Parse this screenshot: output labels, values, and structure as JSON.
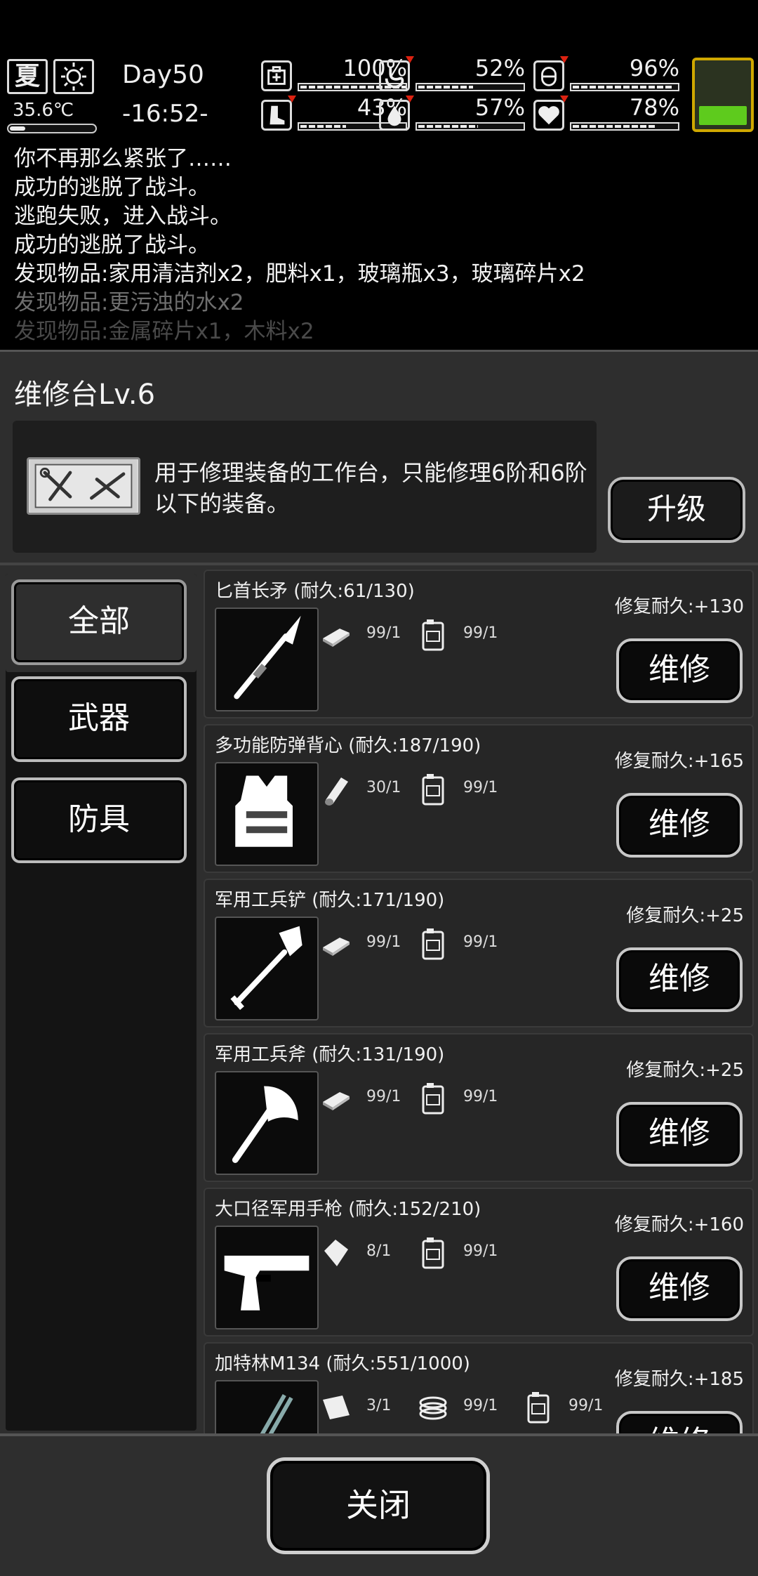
{
  "status": {
    "season": "夏",
    "temperature": "35.6℃",
    "temperature_fill": 0.18,
    "day": "Day50",
    "clock": "-16:52-",
    "battery_level": 0.3,
    "stats": [
      {
        "name": "health",
        "icon": "first-aid-icon",
        "value": "100%",
        "fill": 1.0,
        "falling": false
      },
      {
        "name": "hunger",
        "icon": "stomach-icon",
        "value": "52%",
        "fill": 0.52,
        "falling": true
      },
      {
        "name": "mood",
        "icon": "pill-icon",
        "value": "96%",
        "fill": 0.96,
        "falling": true
      },
      {
        "name": "stamina",
        "icon": "boot-icon",
        "value": "43%",
        "fill": 0.43,
        "falling": true
      },
      {
        "name": "thirst",
        "icon": "water-drop-icon",
        "value": "57%",
        "fill": 0.57,
        "falling": true
      },
      {
        "name": "spirit",
        "icon": "heart-icon",
        "value": "78%",
        "fill": 0.78,
        "falling": true
      }
    ]
  },
  "log": [
    "你不再那么紧张了……",
    "成功的逃脱了战斗。",
    "逃跑失败，进入战斗。",
    "成功的逃脱了战斗。",
    "发现物品:家用清洁剂x2，肥料x1，玻璃瓶x3，玻璃碎片x2",
    "发现物品:更污浊的水x2",
    "发现物品:金属碎片x1，木料x2"
  ],
  "workbench": {
    "title": "维修台Lv.6",
    "description": "用于修理装备的工作台，只能修理6阶和6阶以下的装备。",
    "upgrade_label": "升级"
  },
  "tabs": [
    {
      "label": "全部",
      "active": true
    },
    {
      "label": "武器",
      "active": false
    },
    {
      "label": "防具",
      "active": false
    }
  ],
  "repair_label": "维修",
  "items": [
    {
      "name": "匕首长矛 (耐久:61/130)",
      "repair": "修复耐久:+130",
      "icon": "spear-icon",
      "materials": [
        {
          "icon": "metal-plate-icon",
          "count": "99/1"
        },
        {
          "icon": "jerrycan-icon",
          "count": "99/1"
        }
      ]
    },
    {
      "name": "多功能防弹背心 (耐久:187/190)",
      "repair": "修复耐久:+165",
      "icon": "vest-icon",
      "materials": [
        {
          "icon": "cloth-roll-icon",
          "count": "30/1"
        },
        {
          "icon": "jerrycan-icon",
          "count": "99/1"
        }
      ]
    },
    {
      "name": "军用工兵铲 (耐久:171/190)",
      "repair": "修复耐久:+25",
      "icon": "shovel-icon",
      "materials": [
        {
          "icon": "metal-plate-icon",
          "count": "99/1"
        },
        {
          "icon": "jerrycan-icon",
          "count": "99/1"
        }
      ]
    },
    {
      "name": "军用工兵斧 (耐久:131/190)",
      "repair": "修复耐久:+25",
      "icon": "axe-icon",
      "materials": [
        {
          "icon": "metal-plate-icon",
          "count": "99/1"
        },
        {
          "icon": "jerrycan-icon",
          "count": "99/1"
        }
      ]
    },
    {
      "name": "大口径军用手枪 (耐久:152/210)",
      "repair": "修复耐久:+160",
      "icon": "pistol-icon",
      "materials": [
        {
          "icon": "parts-bag-icon",
          "count": "8/1"
        },
        {
          "icon": "jerrycan-icon",
          "count": "99/1"
        }
      ]
    },
    {
      "name": "加特林M134 (耐久:551/1000)",
      "repair": "修复耐久:+185",
      "icon": "gatling-icon",
      "materials": [
        {
          "icon": "cloth-icon",
          "count": "3/1"
        },
        {
          "icon": "coil-icon",
          "count": "99/1"
        },
        {
          "icon": "jerrycan-icon",
          "count": "99/1"
        }
      ]
    }
  ],
  "close_label": "关闭"
}
